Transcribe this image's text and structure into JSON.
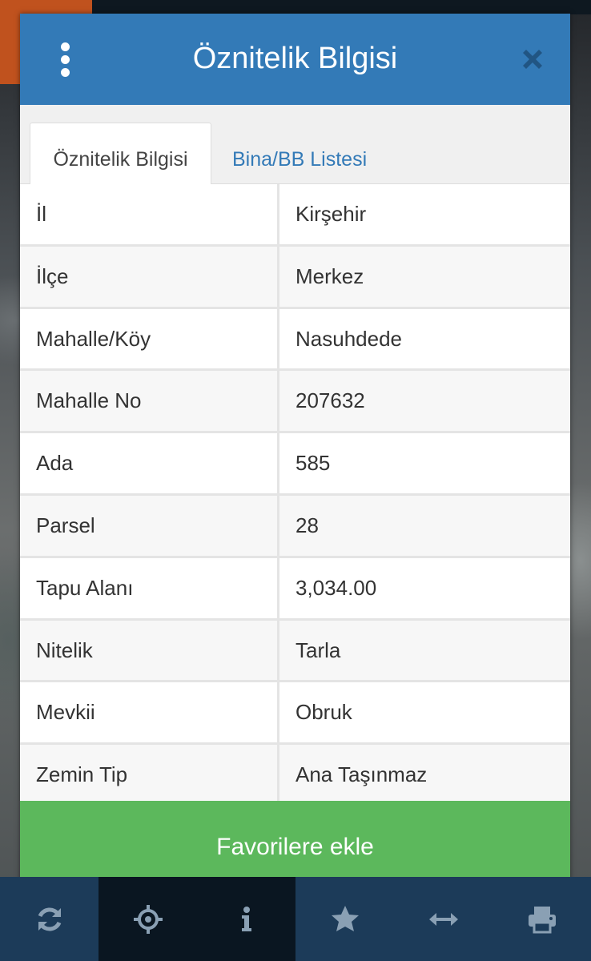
{
  "dialog": {
    "title": "Öznitelik Bilgisi"
  },
  "tabs": [
    {
      "label": "Öznitelik Bilgisi",
      "active": true
    },
    {
      "label": "Bina/BB Listesi",
      "active": false
    }
  ],
  "attributes": [
    {
      "label": "İl",
      "value": "Kirşehir"
    },
    {
      "label": "İlçe",
      "value": "Merkez"
    },
    {
      "label": "Mahalle/Köy",
      "value": "Nasuhdede"
    },
    {
      "label": "Mahalle No",
      "value": "207632"
    },
    {
      "label": "Ada",
      "value": "585"
    },
    {
      "label": "Parsel",
      "value": "28"
    },
    {
      "label": "Tapu Alanı",
      "value": "3,034.00"
    },
    {
      "label": "Nitelik",
      "value": "Tarla"
    },
    {
      "label": "Mevkii",
      "value": "Obruk"
    },
    {
      "label": "Zemin Tip",
      "value": "Ana Taşınmaz"
    }
  ],
  "favorite_button": {
    "label": "Favorilere ekle"
  },
  "toolbar": {
    "items": [
      {
        "icon": "refresh-icon"
      },
      {
        "icon": "crosshair-icon"
      },
      {
        "icon": "info-icon"
      },
      {
        "icon": "star-icon"
      },
      {
        "icon": "measure-arrows-icon"
      },
      {
        "icon": "print-icon"
      }
    ]
  },
  "colors": {
    "header": "#337ab7",
    "tab_link": "#337ab7",
    "favorite_button": "#5cb85c",
    "toolbar": "#1c3b59",
    "toolbar_active": "#0a1621",
    "toolbar_icon": "#8aa0b4"
  }
}
